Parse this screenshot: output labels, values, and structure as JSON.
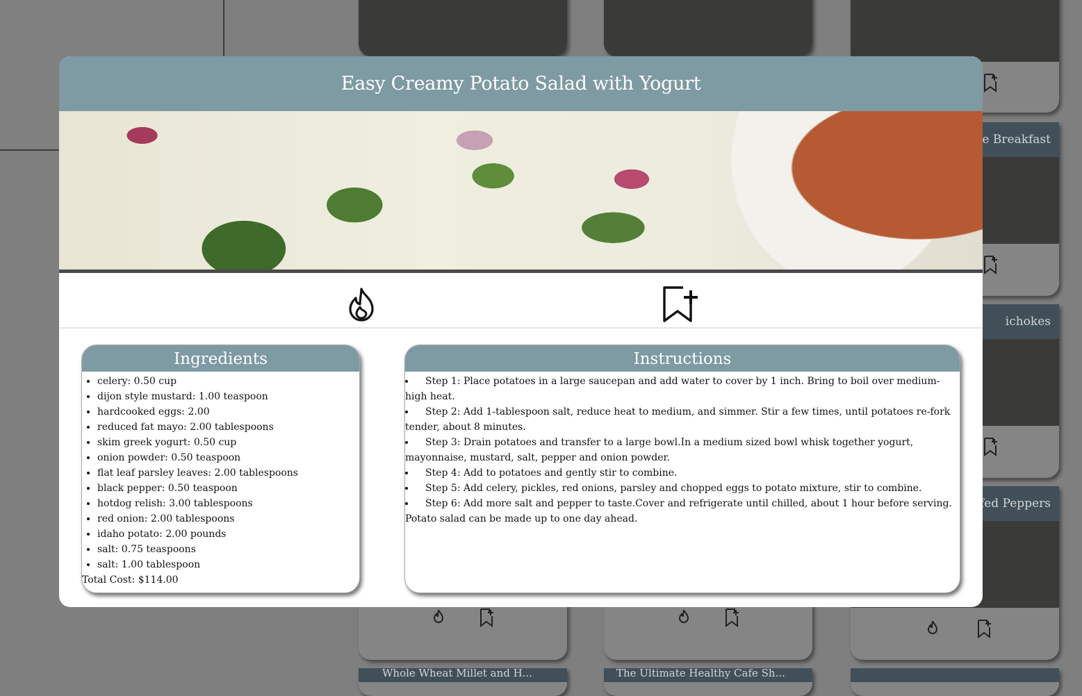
{
  "background": {
    "cards": [
      {
        "title": ""
      },
      {
        "title": ""
      },
      {
        "title": ""
      },
      {
        "title": "e Breakfast"
      },
      {
        "title": "ichokes"
      },
      {
        "title": "uffed Peppers"
      },
      {
        "title": ""
      },
      {
        "title": ""
      },
      {
        "title": ""
      },
      {
        "title": "Whole Wheat Millet and H..."
      },
      {
        "title": "The Ultimate Healthy Cafe Sh..."
      },
      {
        "title": ""
      }
    ]
  },
  "modal": {
    "title": "Easy Creamy Potato Salad with Yogurt",
    "actions": {
      "fire_icon": "fire-icon",
      "bookmark_icon": "bookmark-add-icon"
    },
    "ingredients": {
      "heading": "Ingredients",
      "items": [
        "celery: 0.50 cup",
        "dijon style mustard: 1.00 teaspoon",
        "hardcooked eggs: 2.00",
        "reduced fat mayo: 2.00 tablespoons",
        "skim greek yogurt: 0.50 cup",
        "onion powder: 0.50 teaspoon",
        "flat leaf parsley leaves: 2.00 tablespoons",
        "black pepper: 0.50 teaspoon",
        "hotdog relish: 3.00 tablespoons",
        "red onion: 2.00 tablespoons",
        "idaho potato: 2.00 pounds",
        "salt: 0.75 teaspoons",
        "salt: 1.00 tablespoon"
      ],
      "total": "Total Cost: $114.00"
    },
    "instructions": {
      "heading": "Instructions",
      "steps": [
        "Step 1: Place potatoes in a large saucepan and add water to cover by 1 inch. Bring to boil over medium-high heat.",
        "Step 2: Add 1-tablespoon salt, reduce heat to medium, and simmer. Stir a few times, until potatoes re-fork tender, about 8 minutes.",
        "Step 3: Drain potatoes and transfer to a large bowl.In a medium sized bowl whisk together yogurt, mayonnaise, mustard, salt, pepper and onion powder.",
        "Step 4: Add to potatoes and gently stir to combine.",
        "Step 5: Add celery, pickles, red onions, parsley and chopped eggs to potato mixture, stir to combine.",
        "Step 6: Add more salt and pepper to taste.Cover and refrigerate until chilled, about 1 hour before serving. Potato salad can be made up to one day ahead."
      ]
    }
  }
}
